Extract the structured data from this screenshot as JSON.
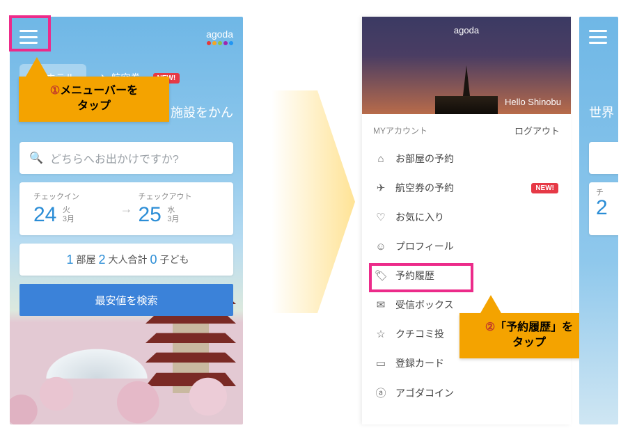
{
  "brand": {
    "name": "agoda"
  },
  "left": {
    "tabs": {
      "hotel": "ホテル",
      "air": "航空券",
      "new": "NEW!"
    },
    "hero": "施設をかん",
    "search_placeholder": "どちらへお出かけですか?",
    "checkin": {
      "label": "チェックイン",
      "day": "24",
      "weekday": "火",
      "month": "3月"
    },
    "checkout": {
      "label": "チェックアウト",
      "day": "25",
      "weekday": "水",
      "month": "3月"
    },
    "guests": {
      "rooms": "1",
      "rooms_label": "部屋",
      "adults": "2",
      "adults_label": "大人合計",
      "children": "0",
      "children_label": "子ども"
    },
    "search_button": "最安値を検索"
  },
  "callouts": {
    "c1_num": "①",
    "c1_a": "メニューバーを",
    "c1_b": "タップ",
    "c2_num": "②",
    "c2_a": "「予約履歴」を",
    "c2_b": "タップ"
  },
  "menu": {
    "hello": "Hello Shinobu",
    "section": "MYアカウント",
    "logout": "ログアウト",
    "new": "NEW!",
    "items": [
      {
        "icon": "⌂",
        "label": "お部屋の予約"
      },
      {
        "icon": "✈",
        "label": "航空券の予約",
        "new": true
      },
      {
        "icon": "♡",
        "label": "お気に入り"
      },
      {
        "icon": "☺",
        "label": "プロフィール"
      },
      {
        "icon": "🏷",
        "label": "予約履歴"
      },
      {
        "icon": "✉",
        "label": "受信ボックス"
      },
      {
        "icon": "☆",
        "label": "クチコミ投"
      },
      {
        "icon": "▭",
        "label": "登録カード"
      },
      {
        "icon": "ⓐ",
        "label": "アゴダコイン"
      }
    ]
  },
  "sliver": {
    "hero": "世界",
    "checkin_label": "チ",
    "day": "2"
  }
}
